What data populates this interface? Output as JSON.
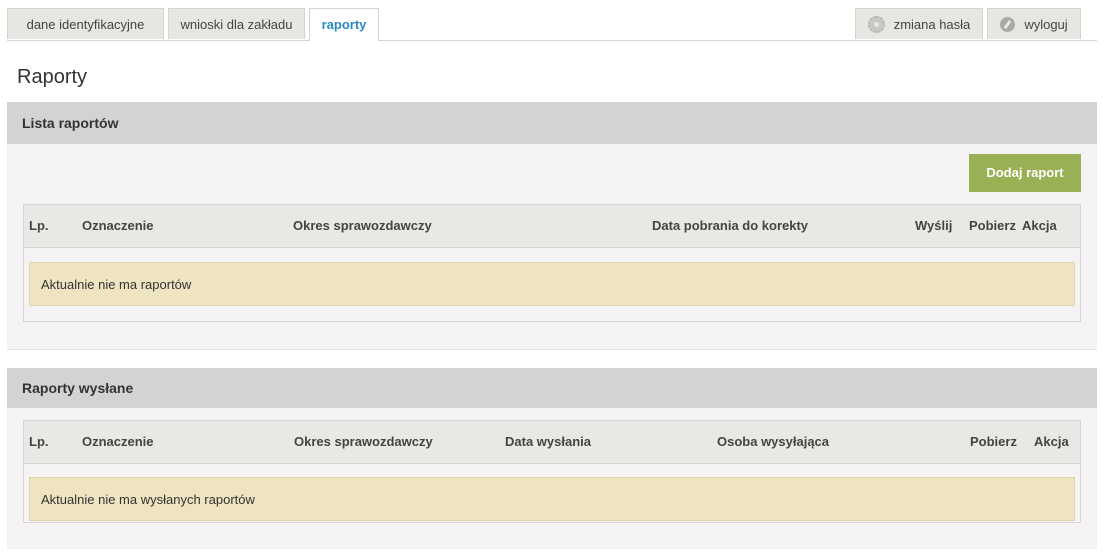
{
  "tabs": [
    {
      "label": "dane identyfikacyjne"
    },
    {
      "label": "wnioski dla zakładu"
    },
    {
      "label": "raporty",
      "active": true
    }
  ],
  "right_tabs": [
    {
      "label": "zmiana hasła",
      "icon": "gear-icon"
    },
    {
      "label": "wyloguj",
      "icon": "power-icon"
    }
  ],
  "page_title": "Raporty",
  "list_section": {
    "title": "Lista raportów",
    "add_button": "Dodaj raport",
    "columns": [
      "Lp.",
      "Oznaczenie",
      "Okres sprawozdawczy",
      "Data pobrania do korekty",
      "Wyślij",
      "Pobierz",
      "Akcja"
    ],
    "empty_message": "Aktualnie nie ma raportów"
  },
  "sent_section": {
    "title": "Raporty wysłane",
    "columns": [
      "Lp.",
      "Oznaczenie",
      "Okres sprawozdawczy",
      "Data wysłania",
      "Osoba wysyłająca",
      "Pobierz",
      "Akcja"
    ],
    "empty_message": "Aktualnie nie ma wysłanych raportów"
  },
  "colors": {
    "accent": "#2a8ac0",
    "button": "#9ab054",
    "section_header": "#d2d3d5",
    "empty_notice": "#efe4c1"
  }
}
